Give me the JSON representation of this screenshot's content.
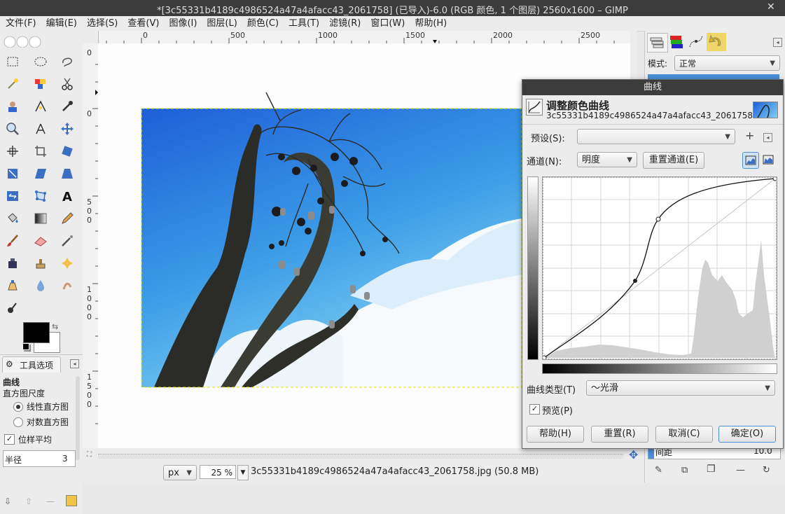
{
  "window": {
    "title": "*[3c55331b4189c4986524a47a4afacc43_2061758] (已导入)-6.0 (RGB 颜色, 1 个图层) 2560x1600 – GIMP",
    "close_glyph": "✕"
  },
  "menu": [
    "文件(F)",
    "编辑(E)",
    "选择(S)",
    "查看(V)",
    "图像(I)",
    "图层(L)",
    "颜色(C)",
    "工具(T)",
    "滤镜(R)",
    "窗口(W)",
    "帮助(H)"
  ],
  "ruler": {
    "top_labels": [
      "0",
      "500",
      "1000",
      "1500",
      "2000",
      "2500"
    ],
    "left_labels": [
      "0",
      "500",
      "1000",
      "1500"
    ]
  },
  "tool_options": {
    "tab_label": "工具选项",
    "tool_name": "曲线",
    "histogram_scale_label": "直方图尺度",
    "linear_label": "线性直方图",
    "log_label": "对数直方图",
    "sample_average_label": "位样平均",
    "radius_label": "半径",
    "radius_value": "3"
  },
  "statusbar": {
    "unit": "px",
    "zoom": "25 %",
    "file_info": "3c55331b4189c4986524a47a4afacc43_2061758.jpg (50.8 MB)"
  },
  "dock": {
    "mode_label": "模式:",
    "mode_value": "正常",
    "opacity_value": "10.0",
    "opacity_label": "间距"
  },
  "dialog": {
    "title": "曲线",
    "heading": "调整颜色曲线",
    "subheading": "3c55331b4189c4986524a47a4afacc43_2061758…",
    "preset_label": "预设(S):",
    "preset_value": "",
    "add_glyph": "+",
    "channel_label": "通道(N):",
    "channel_value": "明度",
    "reset_channel_label": "重置通道(E)",
    "curve_type_label": "曲线类型(T)",
    "curve_type_value": "光滑",
    "preview_label": "预览(P)",
    "buttons": {
      "help": "帮助(H)",
      "reset": "重置(R)",
      "cancel": "取消(C)",
      "ok": "确定(O)"
    }
  },
  "colors": {
    "sky_top": "#1e5fd8",
    "sky_bottom": "#7fd0f3",
    "accent": "#4a90d9"
  }
}
